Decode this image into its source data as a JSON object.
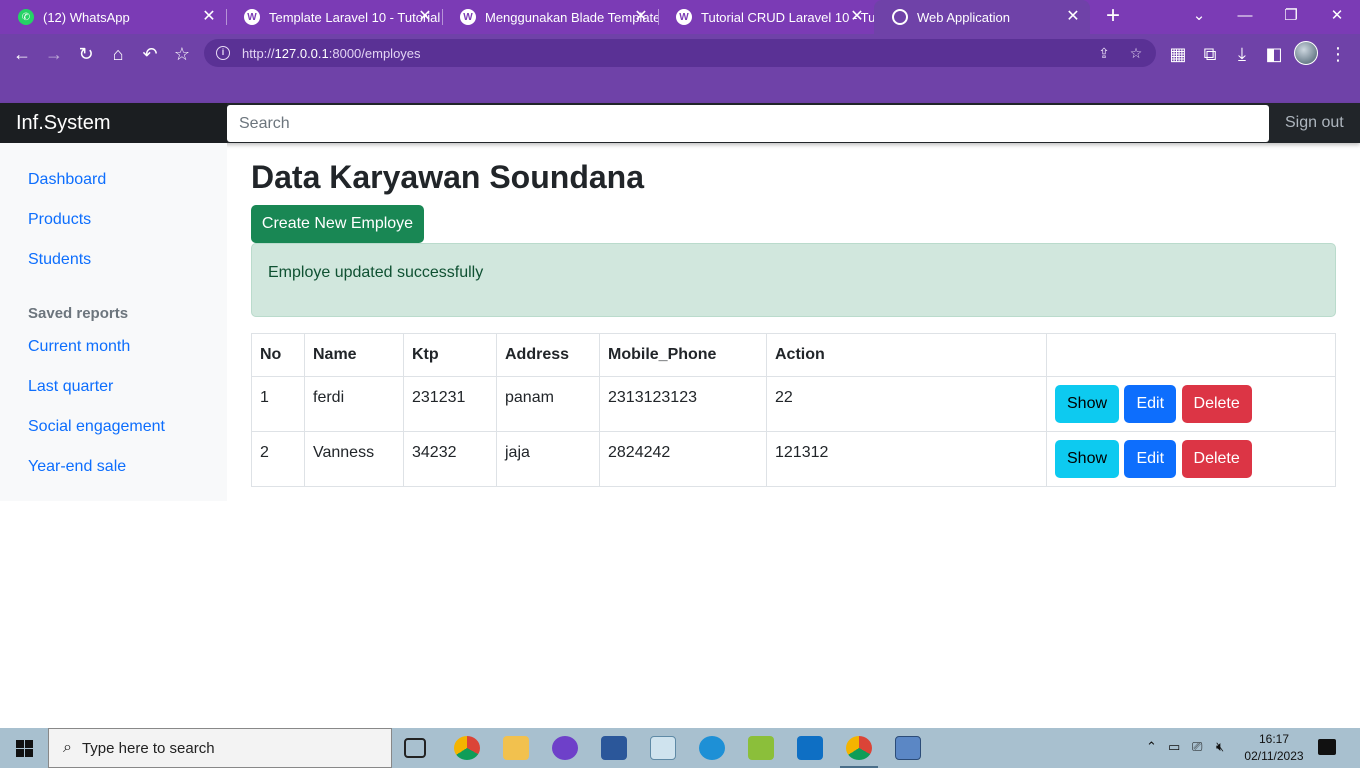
{
  "browser": {
    "tabs": [
      {
        "title": "(12) WhatsApp",
        "favicon": "whatsapp-icon"
      },
      {
        "title": "Template Laravel 10 - Tutorial",
        "favicon": "wordpress-icon"
      },
      {
        "title": "Menggunakan Blade Template",
        "favicon": "wordpress-icon"
      },
      {
        "title": "Tutorial CRUD Laravel 10 - Tu",
        "favicon": "wordpress-icon"
      },
      {
        "title": "Web Application",
        "favicon": "globe-icon",
        "active": true
      }
    ],
    "url_prefix": "http://",
    "url_host": "127.0.0.1",
    "url_rest": ":8000/employes",
    "colors": {
      "frame": "#7b3bb5",
      "toolbar": "#6f42a8"
    }
  },
  "app": {
    "brand": "Inf.System",
    "search_placeholder": "Search",
    "signout": "Sign out"
  },
  "sidebar": {
    "items": [
      {
        "label": "Dashboard"
      },
      {
        "label": "Products"
      },
      {
        "label": "Students"
      }
    ],
    "saved_heading": "Saved reports",
    "reports": [
      {
        "label": "Current month"
      },
      {
        "label": "Last quarter"
      },
      {
        "label": "Social engagement"
      },
      {
        "label": "Year-end sale"
      }
    ]
  },
  "main": {
    "title": "Data Karyawan Soundana",
    "create_button": "Create New Employe",
    "alert": "Employe updated successfully",
    "table": {
      "headers": [
        "No",
        "Name",
        "Ktp",
        "Address",
        "Mobile_Phone",
        "Action",
        ""
      ],
      "rows": [
        {
          "no": "1",
          "name": "ferdi",
          "ktp": "231231",
          "address": "panam",
          "mobile_phone": "2313123123",
          "action": "22"
        },
        {
          "no": "2",
          "name": "Vanness",
          "ktp": "34232",
          "address": "jaja",
          "mobile_phone": "2824242",
          "action": "121312"
        }
      ],
      "show_label": "Show",
      "edit_label": "Edit",
      "delete_label": "Delete"
    }
  },
  "taskbar": {
    "search_placeholder": "Type here to search",
    "time": "16:17",
    "date": "02/11/2023"
  }
}
